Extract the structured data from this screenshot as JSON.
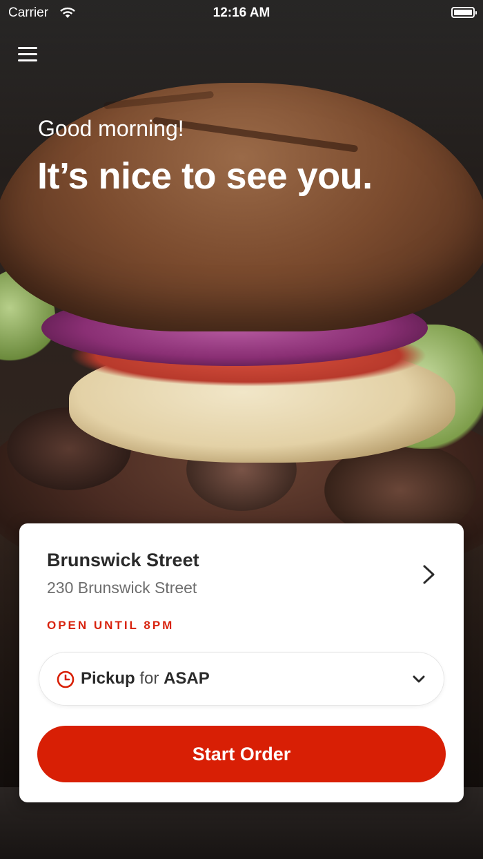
{
  "status_bar": {
    "carrier": "Carrier",
    "time": "12:16 AM",
    "icons": [
      "wifi-icon",
      "battery-icon"
    ]
  },
  "header": {
    "menu_icon": "hamburger-menu-icon",
    "greeting": "Good morning!",
    "headline": "It’s nice to see you."
  },
  "location_card": {
    "store_name": "Brunswick Street",
    "store_address": "230 Brunswick Street",
    "hours": "OPEN UNTIL 8PM",
    "chevron_icon": "chevron-right-icon"
  },
  "order_type": {
    "clock_icon": "clock-icon",
    "mode": "Pickup",
    "for": "for",
    "time": "ASAP",
    "dropdown_icon": "chevron-down-icon"
  },
  "start_button": {
    "label": "Start Order"
  },
  "colors": {
    "accent": "#d81f05",
    "card_bg": "#ffffff",
    "title_text": "#2a2a2a",
    "subtitle_text": "#6e6e6e"
  }
}
